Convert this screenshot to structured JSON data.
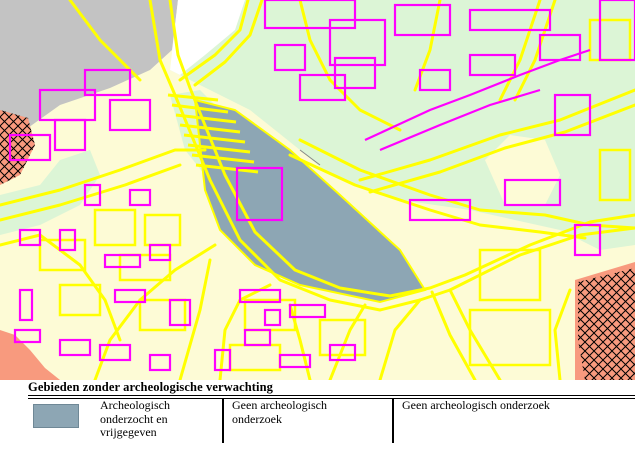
{
  "map": {
    "colors": {
      "pale_yellow": "#fdfbd6",
      "light_green": "#dcf5d6",
      "grey_area": "#c3c3c3",
      "blue_grey_investigated": "#8da6b4",
      "road_yellow": "#ffff00",
      "building_magenta": "#ff00ff",
      "salmon": "#f89a7e",
      "hatch_black": "#000000"
    },
    "icons": [
      "crosshatch-pattern",
      "road-lines",
      "building-outlines"
    ]
  },
  "legend": {
    "title": "Gebieden zonder archeologische verwachting",
    "items": [
      {
        "label_lines": [
          "Archeologisch",
          "onderzocht en",
          "vrijgegeven"
        ],
        "swatch_color": "#8da6b4"
      },
      {
        "label_lines": [
          "Geen archeologisch",
          "onderzoek"
        ]
      },
      {
        "label_lines": [
          "Geen archeologisch onderzoek"
        ]
      }
    ]
  }
}
